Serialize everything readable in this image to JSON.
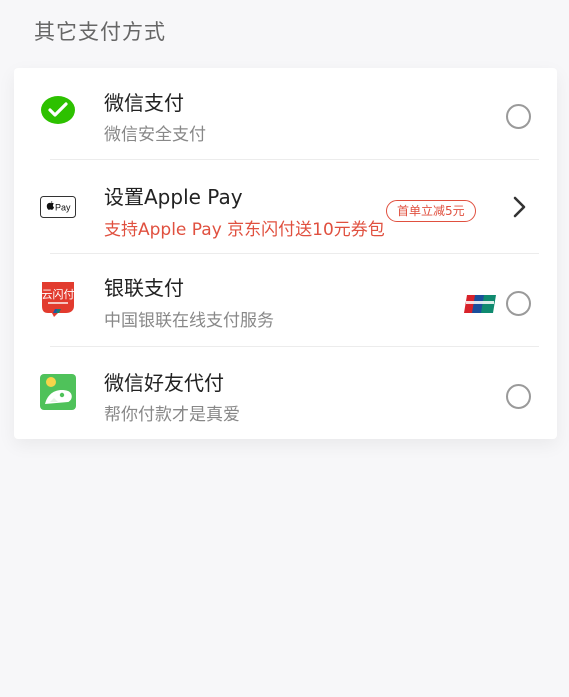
{
  "section": {
    "title": "其它支付方式"
  },
  "colors": {
    "accent_red": "#e0503f",
    "wechat_green": "#2dc100",
    "text_gray": "#888888"
  },
  "methods": [
    {
      "title": "微信支付",
      "subtitle": "微信安全支付",
      "icon": "wechat-pay-icon",
      "control": "radio"
    },
    {
      "title": "设置Apple Pay",
      "subtitle": "支持Apple Pay 京东闪付送10元券包",
      "icon": "apple-pay-icon",
      "badge": "首单立减5元",
      "control": "chevron"
    },
    {
      "title": "银联支付",
      "subtitle": "中国银联在线支付服务",
      "icon": "cloud-quickpass-icon",
      "badge_icon": "unionpay-logo",
      "control": "radio"
    },
    {
      "title": "微信好友代付",
      "subtitle": "帮你付款才是真爱",
      "icon": "wechat-friend-pay-icon",
      "control": "radio"
    }
  ],
  "logo_text": {
    "apple_pay": " Pay",
    "cloud_quickpass": "云闪付"
  }
}
